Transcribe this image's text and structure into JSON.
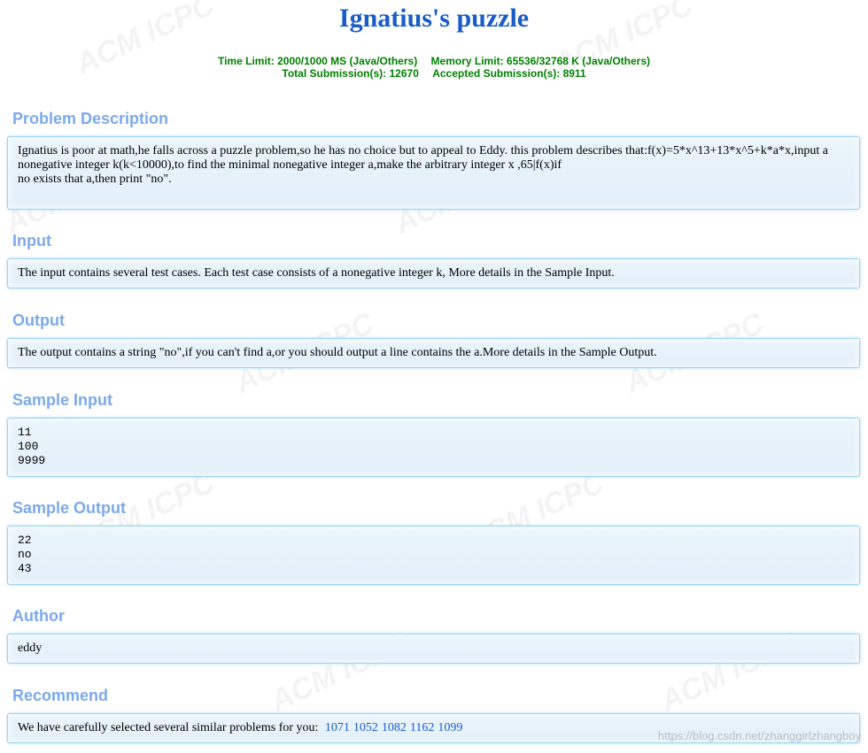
{
  "title": "Ignatius's puzzle",
  "limits": {
    "time_limit": "Time Limit: 2000/1000 MS (Java/Others)",
    "memory_limit": "Memory Limit: 65536/32768 K (Java/Others)",
    "total_submissions": "Total Submission(s): 12670",
    "accepted_submissions": "Accepted Submission(s): 8911"
  },
  "sections": {
    "description": {
      "heading": "Problem Description",
      "line1": "Ignatius is poor at math,he falls across a puzzle problem,so he has no choice but to appeal to Eddy. this problem describes that:f(x)=5*x^13+13*x^5+k*a*x,input a",
      "line2": "nonegative integer k(k<10000),to find the minimal nonegative integer a,make the arbitrary integer x ,65|f(x)if",
      "line3": "no exists that a,then print \"no\"."
    },
    "input": {
      "heading": "Input",
      "text": "The input contains several test cases. Each test case consists of a nonegative integer k, More details in the Sample Input."
    },
    "output": {
      "heading": "Output",
      "text": "The output contains a string \"no\",if you can't find a,or you should output a line contains the a.More details in the Sample Output."
    },
    "sample_input": {
      "heading": "Sample Input",
      "text": "11\n100\n9999"
    },
    "sample_output": {
      "heading": "Sample Output",
      "text": "22\nno\n43"
    },
    "author": {
      "heading": "Author",
      "text": "eddy"
    },
    "recommend": {
      "heading": "Recommend",
      "text": "We have carefully selected several similar problems for you:",
      "links": [
        "1071",
        "1052",
        "1082",
        "1162",
        "1099"
      ]
    }
  },
  "watermark": "ACM ICPC",
  "footer_url": "https://blog.csdn.net/zhanggirlzhangboy"
}
